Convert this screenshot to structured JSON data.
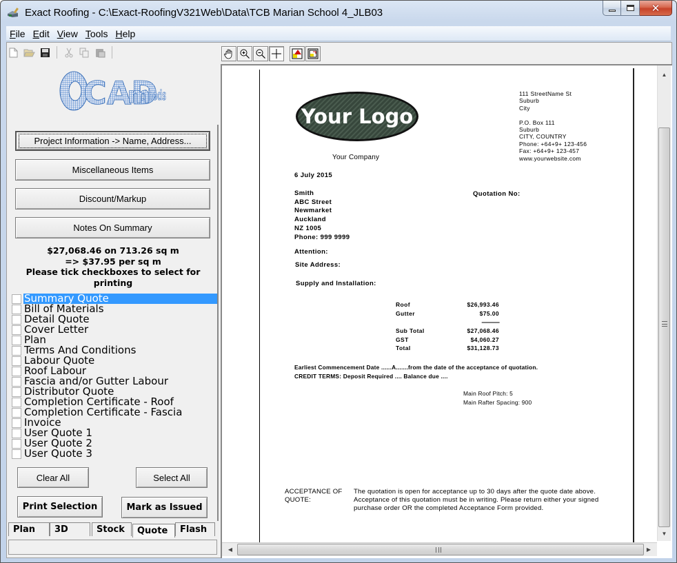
{
  "window": {
    "title": "Exact Roofing - C:\\Exact-RoofingV321Web\\Data\\TCB Marian School 4_JLB03",
    "controls": {
      "minimize": "minimize",
      "maximize": "maximize",
      "close": "✕"
    }
  },
  "menu": [
    {
      "label": "File",
      "accel": "F",
      "rest": "ile"
    },
    {
      "label": "Edit",
      "accel": "E",
      "rest": "dit"
    },
    {
      "label": "View",
      "accel": "V",
      "rest": "iew"
    },
    {
      "label": "Tools",
      "accel": "T",
      "rest": "ools"
    },
    {
      "label": "Help",
      "accel": "H",
      "rest": "elp"
    }
  ],
  "toolbar_icons": [
    "new-file-icon",
    "open-folder-icon",
    "save-icon",
    "cut-icon",
    "copy-icon",
    "paste-icon"
  ],
  "preview_toolbar": [
    "hand-pan-icon",
    "zoom-in-icon",
    "zoom-out-icon",
    "crosshair-icon",
    "export-icon",
    "print-preview-icon"
  ],
  "left": {
    "logo_text": "CADMethods",
    "buttons": {
      "project_info": "Project Information -> Name, Address...",
      "misc_items": "Miscellaneous Items",
      "discount": "Discount/Markup",
      "notes": "Notes On Summary"
    },
    "summary": {
      "line1": "$27,068.46 on 713.26 sq m",
      "line2": "=>  $37.95 per sq m",
      "line3": "Please tick checkboxes to select for printing"
    },
    "checklist": [
      {
        "label": "Summary Quote",
        "checked": false,
        "selected": true
      },
      {
        "label": "Bill of Materials",
        "checked": false,
        "selected": false
      },
      {
        "label": "Detail Quote",
        "checked": false,
        "selected": false
      },
      {
        "label": "Cover Letter",
        "checked": false,
        "selected": false
      },
      {
        "label": "Plan",
        "checked": false,
        "selected": false
      },
      {
        "label": "Terms And Conditions",
        "checked": false,
        "selected": false
      },
      {
        "label": "Labour Quote",
        "checked": false,
        "selected": false
      },
      {
        "label": "Roof Labour",
        "checked": false,
        "selected": false
      },
      {
        "label": "Fascia and/or Gutter Labour",
        "checked": false,
        "selected": false
      },
      {
        "label": "Distributor Quote",
        "checked": false,
        "selected": false
      },
      {
        "label": "Completion Certificate - Roof",
        "checked": false,
        "selected": false
      },
      {
        "label": "Completion Certificate - Fascia",
        "checked": false,
        "selected": false
      },
      {
        "label": "Invoice",
        "checked": false,
        "selected": false
      },
      {
        "label": "User Quote 1",
        "checked": false,
        "selected": false
      },
      {
        "label": "User Quote 2",
        "checked": false,
        "selected": false
      },
      {
        "label": "User Quote 3",
        "checked": false,
        "selected": false
      }
    ],
    "clear_all": "Clear All",
    "select_all": "Select All",
    "print_selection": "Print Selection",
    "mark_issued": "Mark as Issued",
    "tabs": [
      {
        "label": "Plan",
        "active": false
      },
      {
        "label": "3D",
        "active": false
      },
      {
        "label": "Stock",
        "active": false
      },
      {
        "label": "Quote",
        "active": true
      },
      {
        "label": "Flash",
        "active": false
      }
    ]
  },
  "document": {
    "logo_text": "Your Logo",
    "company_name": "Your Company",
    "company_address": [
      "111 StreetName St",
      "Suburb",
      "City",
      "",
      "P.O. Box  111",
      "Suburb",
      "CITY, COUNTRY",
      "Phone: +64+9+ 123-456",
      "Fax: +64+9+ 123-457",
      "www.yourwebsite.com"
    ],
    "date": "6 July 2015",
    "client": {
      "name": "Smith",
      "street": "ABC Street",
      "suburb": "Newmarket",
      "city": "Auckland",
      "postcode": "NZ 1005",
      "phone": "Phone: 999 9999"
    },
    "quotation_no_label": "Quotation No:",
    "attention_label": "Attention:",
    "site_address_label": "Site Address:",
    "supply_label": "Supply and Installation:",
    "line_items": [
      {
        "label": "Roof",
        "amount": "$26,993.46"
      },
      {
        "label": "Gutter",
        "amount": "$75.00"
      }
    ],
    "separator": "--------------",
    "totals": [
      {
        "label": "Sub Total",
        "amount": "$27,068.46"
      },
      {
        "label": "GST",
        "amount": "$4,060.27"
      },
      {
        "label": "Total",
        "amount": "$31,128.73"
      }
    ],
    "commencement": "Earliest Commencement Date ......A.......from the date of the acceptance of quotation.",
    "credit_terms": "CREDIT TERMS: Deposit Required .... Balance due  ....",
    "roof_pitch": "Main Roof Pitch: 5",
    "rafter_spacing": "Main Rafter Spacing: 900",
    "acceptance_label": "ACCEPTANCE OF QUOTE:",
    "acceptance_text": "The quotation is open for acceptance up to 30 days after the quote date above.  Acceptance of this quotation must be in writing.  Please return either your signed purchase order OR the completed Acceptance Form provided."
  }
}
